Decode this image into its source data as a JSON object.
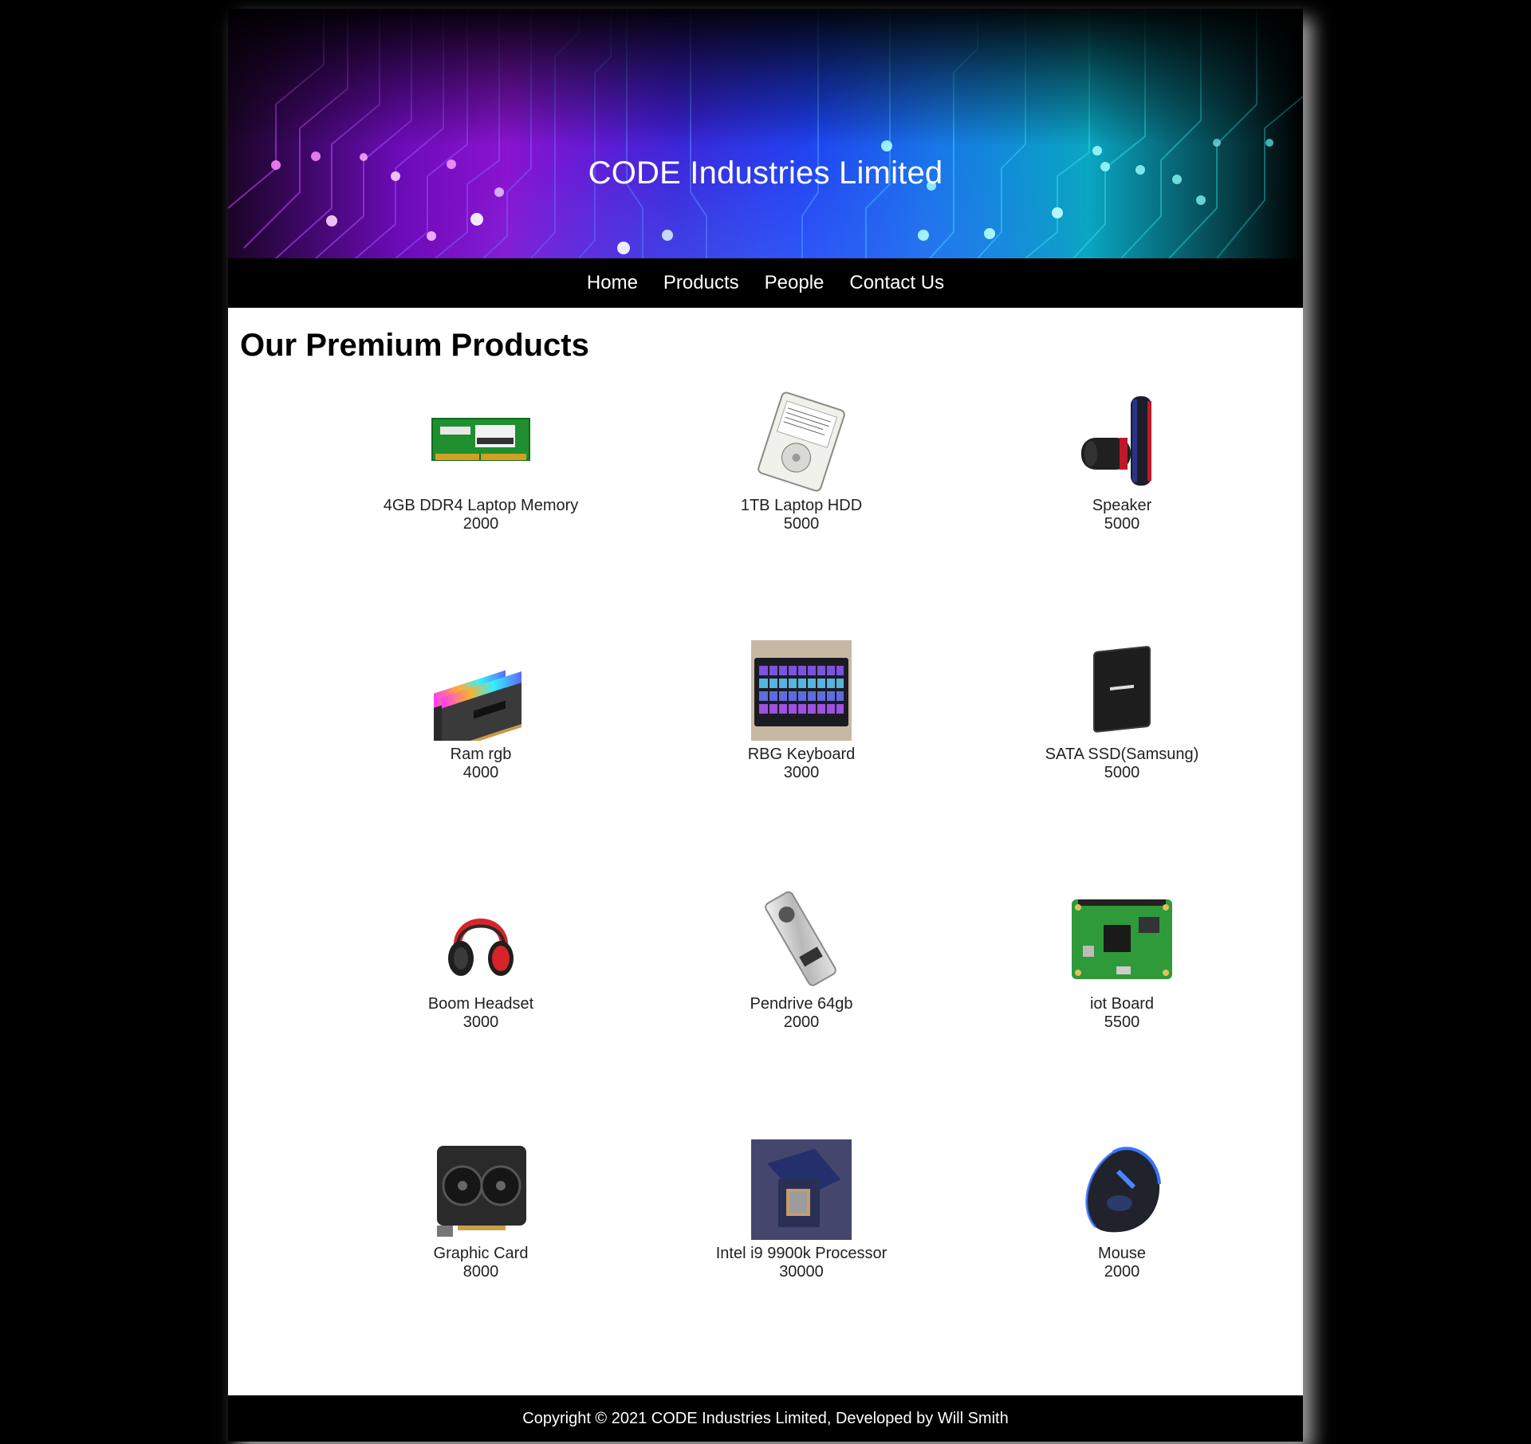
{
  "header": {
    "title": "CODE Industries Limited"
  },
  "nav": {
    "items": [
      "Home",
      "Products",
      "People",
      "Contact Us"
    ]
  },
  "main": {
    "heading": "Our Premium Products",
    "products": [
      {
        "name": "4GB DDR4 Laptop Memory",
        "price": "2000",
        "icon": "ram-stick-icon"
      },
      {
        "name": "1TB Laptop HDD",
        "price": "5000",
        "icon": "hdd-icon"
      },
      {
        "name": "Speaker",
        "price": "5000",
        "icon": "speaker-icon"
      },
      {
        "name": "Ram rgb",
        "price": "4000",
        "icon": "rgb-ram-icon"
      },
      {
        "name": "RBG Keyboard",
        "price": "3000",
        "icon": "keyboard-icon"
      },
      {
        "name": "SATA SSD(Samsung)",
        "price": "5000",
        "icon": "ssd-icon"
      },
      {
        "name": "Boom Headset",
        "price": "3000",
        "icon": "headset-icon"
      },
      {
        "name": "Pendrive 64gb",
        "price": "2000",
        "icon": "pendrive-icon"
      },
      {
        "name": "iot Board",
        "price": "5500",
        "icon": "iot-board-icon"
      },
      {
        "name": "Graphic Card",
        "price": "8000",
        "icon": "graphics-card-icon"
      },
      {
        "name": "Intel i9 9900k Processor",
        "price": "30000",
        "icon": "processor-icon"
      },
      {
        "name": "Mouse",
        "price": "2000",
        "icon": "mouse-icon"
      }
    ]
  },
  "footer": {
    "text": "Copyright © 2021 CODE Industries Limited, Developed by Will Smith"
  }
}
